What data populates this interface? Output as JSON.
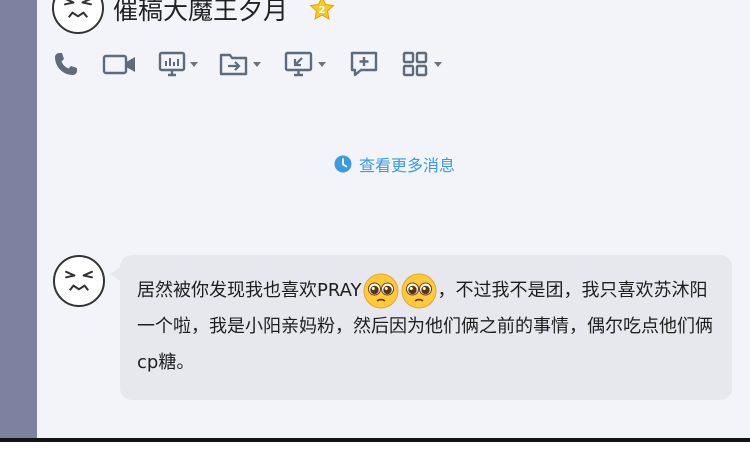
{
  "header": {
    "contact_name": "催稿大魔王夕月",
    "vip_badge_icon": "vip-crown-icon"
  },
  "toolbar": {
    "items": [
      {
        "name": "voice-call",
        "icon": "phone-icon",
        "has_dropdown": false
      },
      {
        "name": "video-call",
        "icon": "video-camera-icon",
        "has_dropdown": false
      },
      {
        "name": "screen-share",
        "icon": "screen-share-icon",
        "has_dropdown": true
      },
      {
        "name": "send-file",
        "icon": "folder-transfer-icon",
        "has_dropdown": true
      },
      {
        "name": "remote-control",
        "icon": "remote-desktop-icon",
        "has_dropdown": true
      },
      {
        "name": "create-group-chat",
        "icon": "add-chat-icon",
        "has_dropdown": false
      },
      {
        "name": "apps",
        "icon": "apps-grid-icon",
        "has_dropdown": true
      }
    ]
  },
  "history": {
    "view_more_label": "查看更多消息"
  },
  "message": {
    "text_part1": "居然被你发现我也喜欢PRAY",
    "emoji": "pleading-face-emoji",
    "text_part2": "，不过我不是团，我只喜欢苏沐阳一个啦，我是小阳亲妈粉，然后因为他们俩之前的事情，偶尔吃点他们俩cp糖。"
  },
  "colors": {
    "accent": "#3a9be0",
    "bubble": "#e6e8ee",
    "chat_background": "#f2f4fa",
    "side_strip": "#7c82a0",
    "icon": "#5f6b7a"
  }
}
